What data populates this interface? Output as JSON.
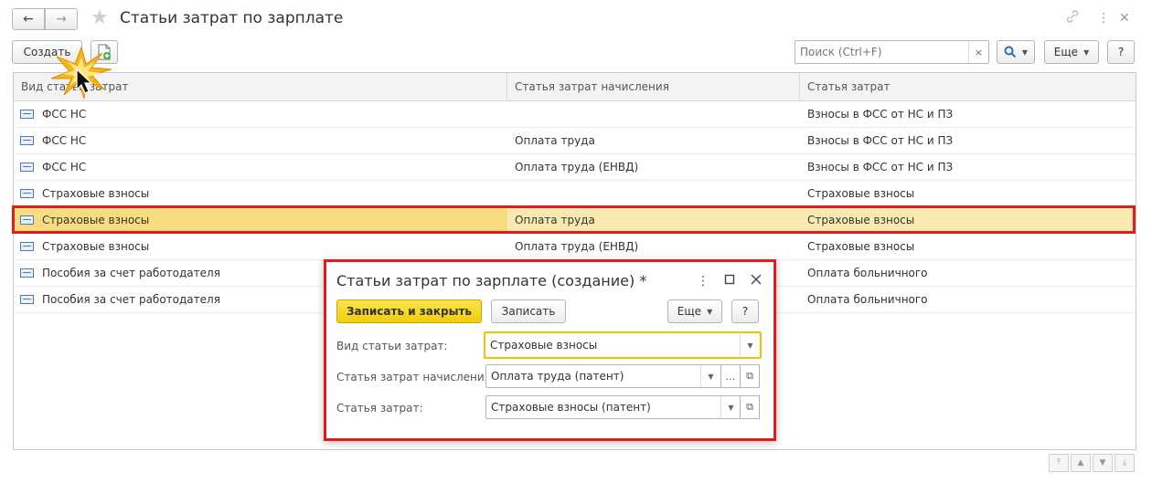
{
  "window": {
    "title": "Статьи затрат по зарплате",
    "back_icon": "←",
    "forward_icon": "→",
    "link_icon": "🔗",
    "menu_icon": "⋮",
    "close_icon": "✕"
  },
  "toolbar": {
    "create_label": "Создать",
    "search_placeholder": "Поиск (Ctrl+F)",
    "search_clear": "×",
    "more_label": "Еще",
    "help_label": "?"
  },
  "table": {
    "columns": [
      "Вид статьи затрат",
      "Статья затрат начисления",
      "Статья затрат"
    ],
    "rows": [
      {
        "kind": "ФСС НС",
        "accrual": "",
        "cost": "Взносы в ФСС от НС и ПЗ"
      },
      {
        "kind": "ФСС НС",
        "accrual": "Оплата труда",
        "cost": "Взносы в ФСС от НС и ПЗ"
      },
      {
        "kind": "ФСС НС",
        "accrual": "Оплата труда (ЕНВД)",
        "cost": "Взносы в ФСС от НС и ПЗ"
      },
      {
        "kind": "Страховые взносы",
        "accrual": "",
        "cost": "Страховые взносы"
      },
      {
        "kind": "Страховые взносы",
        "accrual": "Оплата труда",
        "cost": "Страховые взносы"
      },
      {
        "kind": "Страховые взносы",
        "accrual": "Оплата труда (ЕНВД)",
        "cost": "Страховые взносы"
      },
      {
        "kind": "Пособия за счет работодателя",
        "accrual": "",
        "cost": "Оплата больничного"
      },
      {
        "kind": "Пособия за счет работодателя",
        "accrual": "",
        "cost": "Оплата больничного"
      }
    ],
    "selected_row": 4
  },
  "dialog": {
    "title": "Статьи затрат по зарплате (создание) *",
    "save_close_label": "Записать и закрыть",
    "save_label": "Записать",
    "more_label": "Еще",
    "help_label": "?",
    "fields": [
      {
        "label": "Вид статьи затрат:",
        "value": "Страховые взносы"
      },
      {
        "label": "Статья затрат начисления:",
        "value": "Оплата труда (патент)"
      },
      {
        "label": "Статья затрат:",
        "value": "Страховые взносы (патент)"
      }
    ]
  },
  "colors": {
    "highlight": "#e01c1c",
    "selected_row": "#fbeab0",
    "primary_button": "#f5d51a"
  }
}
